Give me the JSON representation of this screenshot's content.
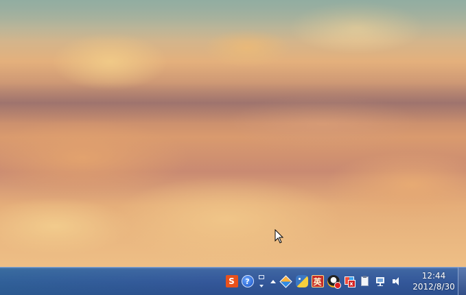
{
  "wallpaper": {
    "description_colors": {
      "sky": "#9fb3a4",
      "sand_light": "#f0c987",
      "sand_dark": "#b9826e"
    }
  },
  "taskbar": {
    "background": "#34589a",
    "tray_icons": [
      {
        "name": "sogou-ime-icon",
        "glyph": "S",
        "color": "#e9511c"
      },
      {
        "name": "help-icon",
        "glyph": "?",
        "color": "#1750c4"
      },
      {
        "name": "ime-toggle-icon"
      },
      {
        "name": "show-hidden-icons-arrow"
      },
      {
        "name": "diamond-app-icon"
      },
      {
        "name": "python-icon"
      },
      {
        "name": "youdao-dict-icon",
        "glyph": "英",
        "color": "#c62d28"
      },
      {
        "name": "qq-icon"
      },
      {
        "name": "flag-alert-icon",
        "glyph": "x"
      },
      {
        "name": "clipboard-icon"
      },
      {
        "name": "network-icon"
      },
      {
        "name": "volume-icon"
      }
    ],
    "clock": {
      "time": "12:44",
      "date": "2012/8/30"
    }
  }
}
